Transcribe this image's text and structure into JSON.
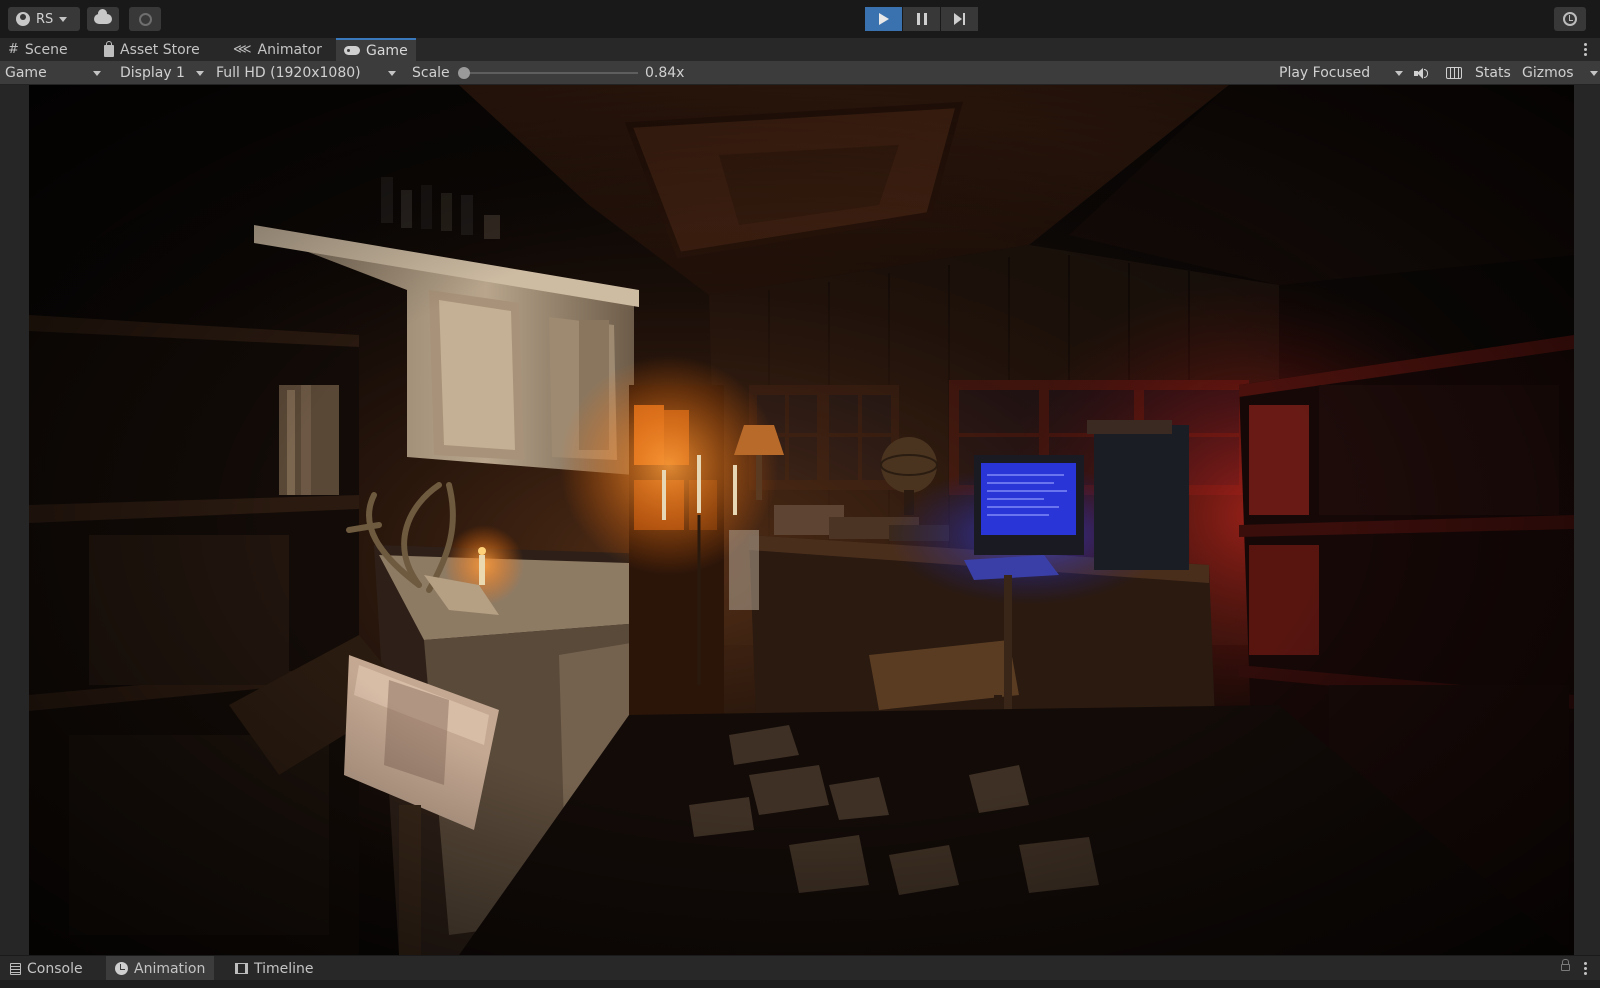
{
  "toolbar": {
    "account_label": "RS",
    "icons": [
      "account-icon",
      "cloud-icon",
      "collab-icon",
      "play-icon",
      "pause-icon",
      "step-icon",
      "history-icon"
    ],
    "play_active_color": "#3a72b0"
  },
  "tabs": [
    {
      "label": "Scene",
      "icon": "hash-icon"
    },
    {
      "label": "Asset Store",
      "icon": "bag-icon"
    },
    {
      "label": "Animator",
      "icon": "animator-icon"
    },
    {
      "label": "Game",
      "icon": "gamepad-icon",
      "active": true
    }
  ],
  "game_controls": {
    "view_mode": "Game",
    "display": "Display 1",
    "resolution": "Full HD (1920x1080)",
    "scale_label": "Scale",
    "scale_value": "0.84x",
    "play_mode": "Play Focused",
    "stats_label": "Stats",
    "gizmos_label": "Gizmos"
  },
  "bottom_tabs": [
    {
      "label": "Console",
      "icon": "console-icon"
    },
    {
      "label": "Animation",
      "icon": "clock-icon",
      "active": true
    },
    {
      "label": "Timeline",
      "icon": "timeline-icon"
    }
  ],
  "colors": {
    "editor_bg": "#191919",
    "panel_bg": "#3c3c3c",
    "tab_accent": "#3a79bb",
    "monitor_glow": "#2a35d8",
    "candle_glow": "#ff8a2a",
    "red_light": "#b3221c"
  }
}
